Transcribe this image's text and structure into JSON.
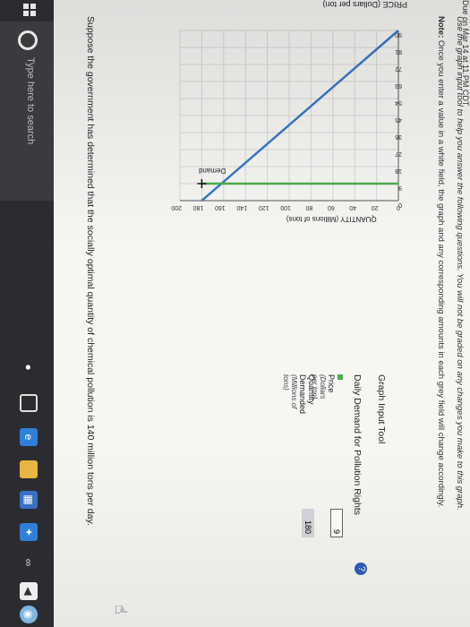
{
  "header": {
    "crumb": "Due on Mar 14 at 11 PM CDT",
    "instructions": "Use the graph input tool to help you answer the following questions. You will not be graded on any changes you make to this graph.",
    "note_label": "Note:",
    "note_text": "Once you enter a value in a white field, the graph and any corresponding amounts in each grey field will change accordingly."
  },
  "graph": {
    "ylabel": "PRICE (Dollars per ton)",
    "xlabel": "QUANTITY (Millions of tons)",
    "demand_label": "Demand",
    "y_ticks": [
      "90",
      "81",
      "72",
      "63",
      "54",
      "45",
      "36",
      "27",
      "18",
      "9",
      "0"
    ],
    "x_ticks": [
      "0",
      "20",
      "40",
      "60",
      "80",
      "100",
      "120",
      "140",
      "160",
      "180",
      "200"
    ]
  },
  "chart_data": {
    "type": "line",
    "xlabel": "QUANTITY (Millions of tons)",
    "ylabel": "PRICE (Dollars per ton)",
    "xlim": [
      0,
      200
    ],
    "ylim": [
      0,
      90
    ],
    "series": [
      {
        "name": "Demand",
        "x": [
          0,
          180
        ],
        "y": [
          90,
          0
        ],
        "color": "#3a78c9"
      },
      {
        "name": "",
        "x": [
          0,
          180
        ],
        "y": [
          9,
          9
        ],
        "color": "#4fae4f"
      }
    ],
    "marker": {
      "x": 180,
      "y": 9
    }
  },
  "tool": {
    "title": "Graph Input Tool",
    "subtitle": "Daily Demand for Pollution Rights",
    "price_label": "Price",
    "price_unit": "(Dollars per ton)",
    "price_value": "9",
    "qty_label1": "Quantity",
    "qty_label2": "Demanded",
    "qty_unit": "(Millions of tons)",
    "qty_value": "180",
    "help": "?"
  },
  "question": "Suppose the government has determined that the socially optimal quantity of chemical pollution is 140 million tons per day.",
  "taskbar": {
    "search_placeholder": "Type here to search",
    "colors": {
      "taskbar": "#2b2c2f",
      "edge": "#2f7fd6"
    }
  }
}
